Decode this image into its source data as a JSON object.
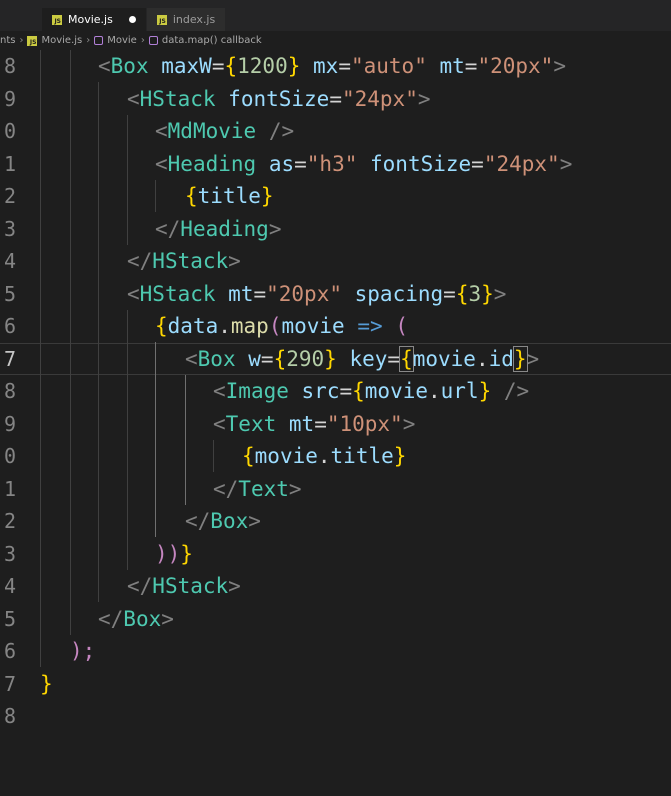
{
  "tabs": [
    {
      "label": "Movie.js",
      "active": true,
      "modified": true,
      "icon": "js-file-icon"
    },
    {
      "label": "index.js",
      "active": false,
      "modified": false,
      "icon": "js-file-icon"
    }
  ],
  "breadcrumb": {
    "items": [
      "nts",
      "Movie.js",
      "Movie",
      "data.map() callback"
    ]
  },
  "line_numbers": [
    "8",
    "9",
    "0",
    "1",
    "2",
    "3",
    "4",
    "5",
    "6",
    "7",
    "8",
    "9",
    "0",
    "1",
    "2",
    "3",
    "4",
    "5",
    "6",
    "7",
    "8"
  ],
  "code": {
    "l0": {
      "p1": "<",
      "c1": "Box",
      "a1": "maxW",
      "e1": "=",
      "b1": "{",
      "n1": "1200",
      "b2": "}",
      "a2": "mx",
      "e2": "=",
      "s1": "\"auto\"",
      "a3": "mt",
      "e3": "=",
      "s2": "\"20px\"",
      "p2": ">"
    },
    "l1": {
      "p1": "<",
      "c1": "HStack",
      "a1": "fontSize",
      "e1": "=",
      "s1": "\"24px\"",
      "p2": ">"
    },
    "l2": {
      "p1": "<",
      "c1": "MdMovie",
      "p2": " />"
    },
    "l3": {
      "p1": "<",
      "c1": "Heading",
      "a1": "as",
      "e1": "=",
      "s1": "\"h3\"",
      "a2": "fontSize",
      "e2": "=",
      "s2": "\"24px\"",
      "p2": ">"
    },
    "l4": {
      "b1": "{",
      "v1": "title",
      "b2": "}"
    },
    "l5": {
      "p1": "</",
      "c1": "Heading",
      "p2": ">"
    },
    "l6": {
      "p1": "</",
      "c1": "HStack",
      "p2": ">"
    },
    "l7": {
      "p1": "<",
      "c1": "HStack",
      "a1": "mt",
      "e1": "=",
      "s1": "\"20px\"",
      "a2": "spacing",
      "e2": "=",
      "b1": "{",
      "n1": "3",
      "b2": "}",
      "p2": ">"
    },
    "l8": {
      "b1": "{",
      "v1": "data",
      "d1": ".",
      "f1": "map",
      "m1": "(",
      "v2": "movie",
      "k1": "=>",
      "m2": "("
    },
    "l9": {
      "p1": "<",
      "c1": "Box",
      "a1": "w",
      "e1": "=",
      "b1": "{",
      "n1": "290",
      "b2": "}",
      "a2": "key",
      "e2": "=",
      "b3": "{",
      "v1": "movie",
      "d1": ".",
      "v2": "id",
      "b4": "}",
      "p2": ">"
    },
    "l10": {
      "p1": "<",
      "c1": "Image",
      "a1": "src",
      "e1": "=",
      "b1": "{",
      "v1": "movie",
      "d1": ".",
      "v2": "url",
      "b2": "}",
      "p2": " />"
    },
    "l11": {
      "p1": "<",
      "c1": "Text",
      "a1": "mt",
      "e1": "=",
      "s1": "\"10px\"",
      "p2": ">"
    },
    "l12": {
      "b1": "{",
      "v1": "movie",
      "d1": ".",
      "v2": "title",
      "b2": "}"
    },
    "l13": {
      "p1": "</",
      "c1": "Text",
      "p2": ">"
    },
    "l14": {
      "p1": "</",
      "c1": "Box",
      "p2": ">"
    },
    "l15": {
      "m1": "))",
      "b1": "}"
    },
    "l16": {
      "p1": "</",
      "c1": "HStack",
      "p2": ">"
    },
    "l17": {
      "p1": "</",
      "c1": "Box",
      "p2": ">"
    },
    "l18": {
      "m1": ");"
    },
    "l19": {
      "b1": "}"
    },
    "l20": {}
  },
  "colors": {
    "background": "#1e1e1e",
    "tag_bracket": "#808080",
    "component": "#4ec9b0",
    "attribute": "#9cdcfe",
    "string": "#ce9178",
    "number": "#b5cea8",
    "brace": "#ffd700",
    "paren": "#c586c0",
    "function": "#dcdcaa",
    "keyword": "#569cd6"
  }
}
